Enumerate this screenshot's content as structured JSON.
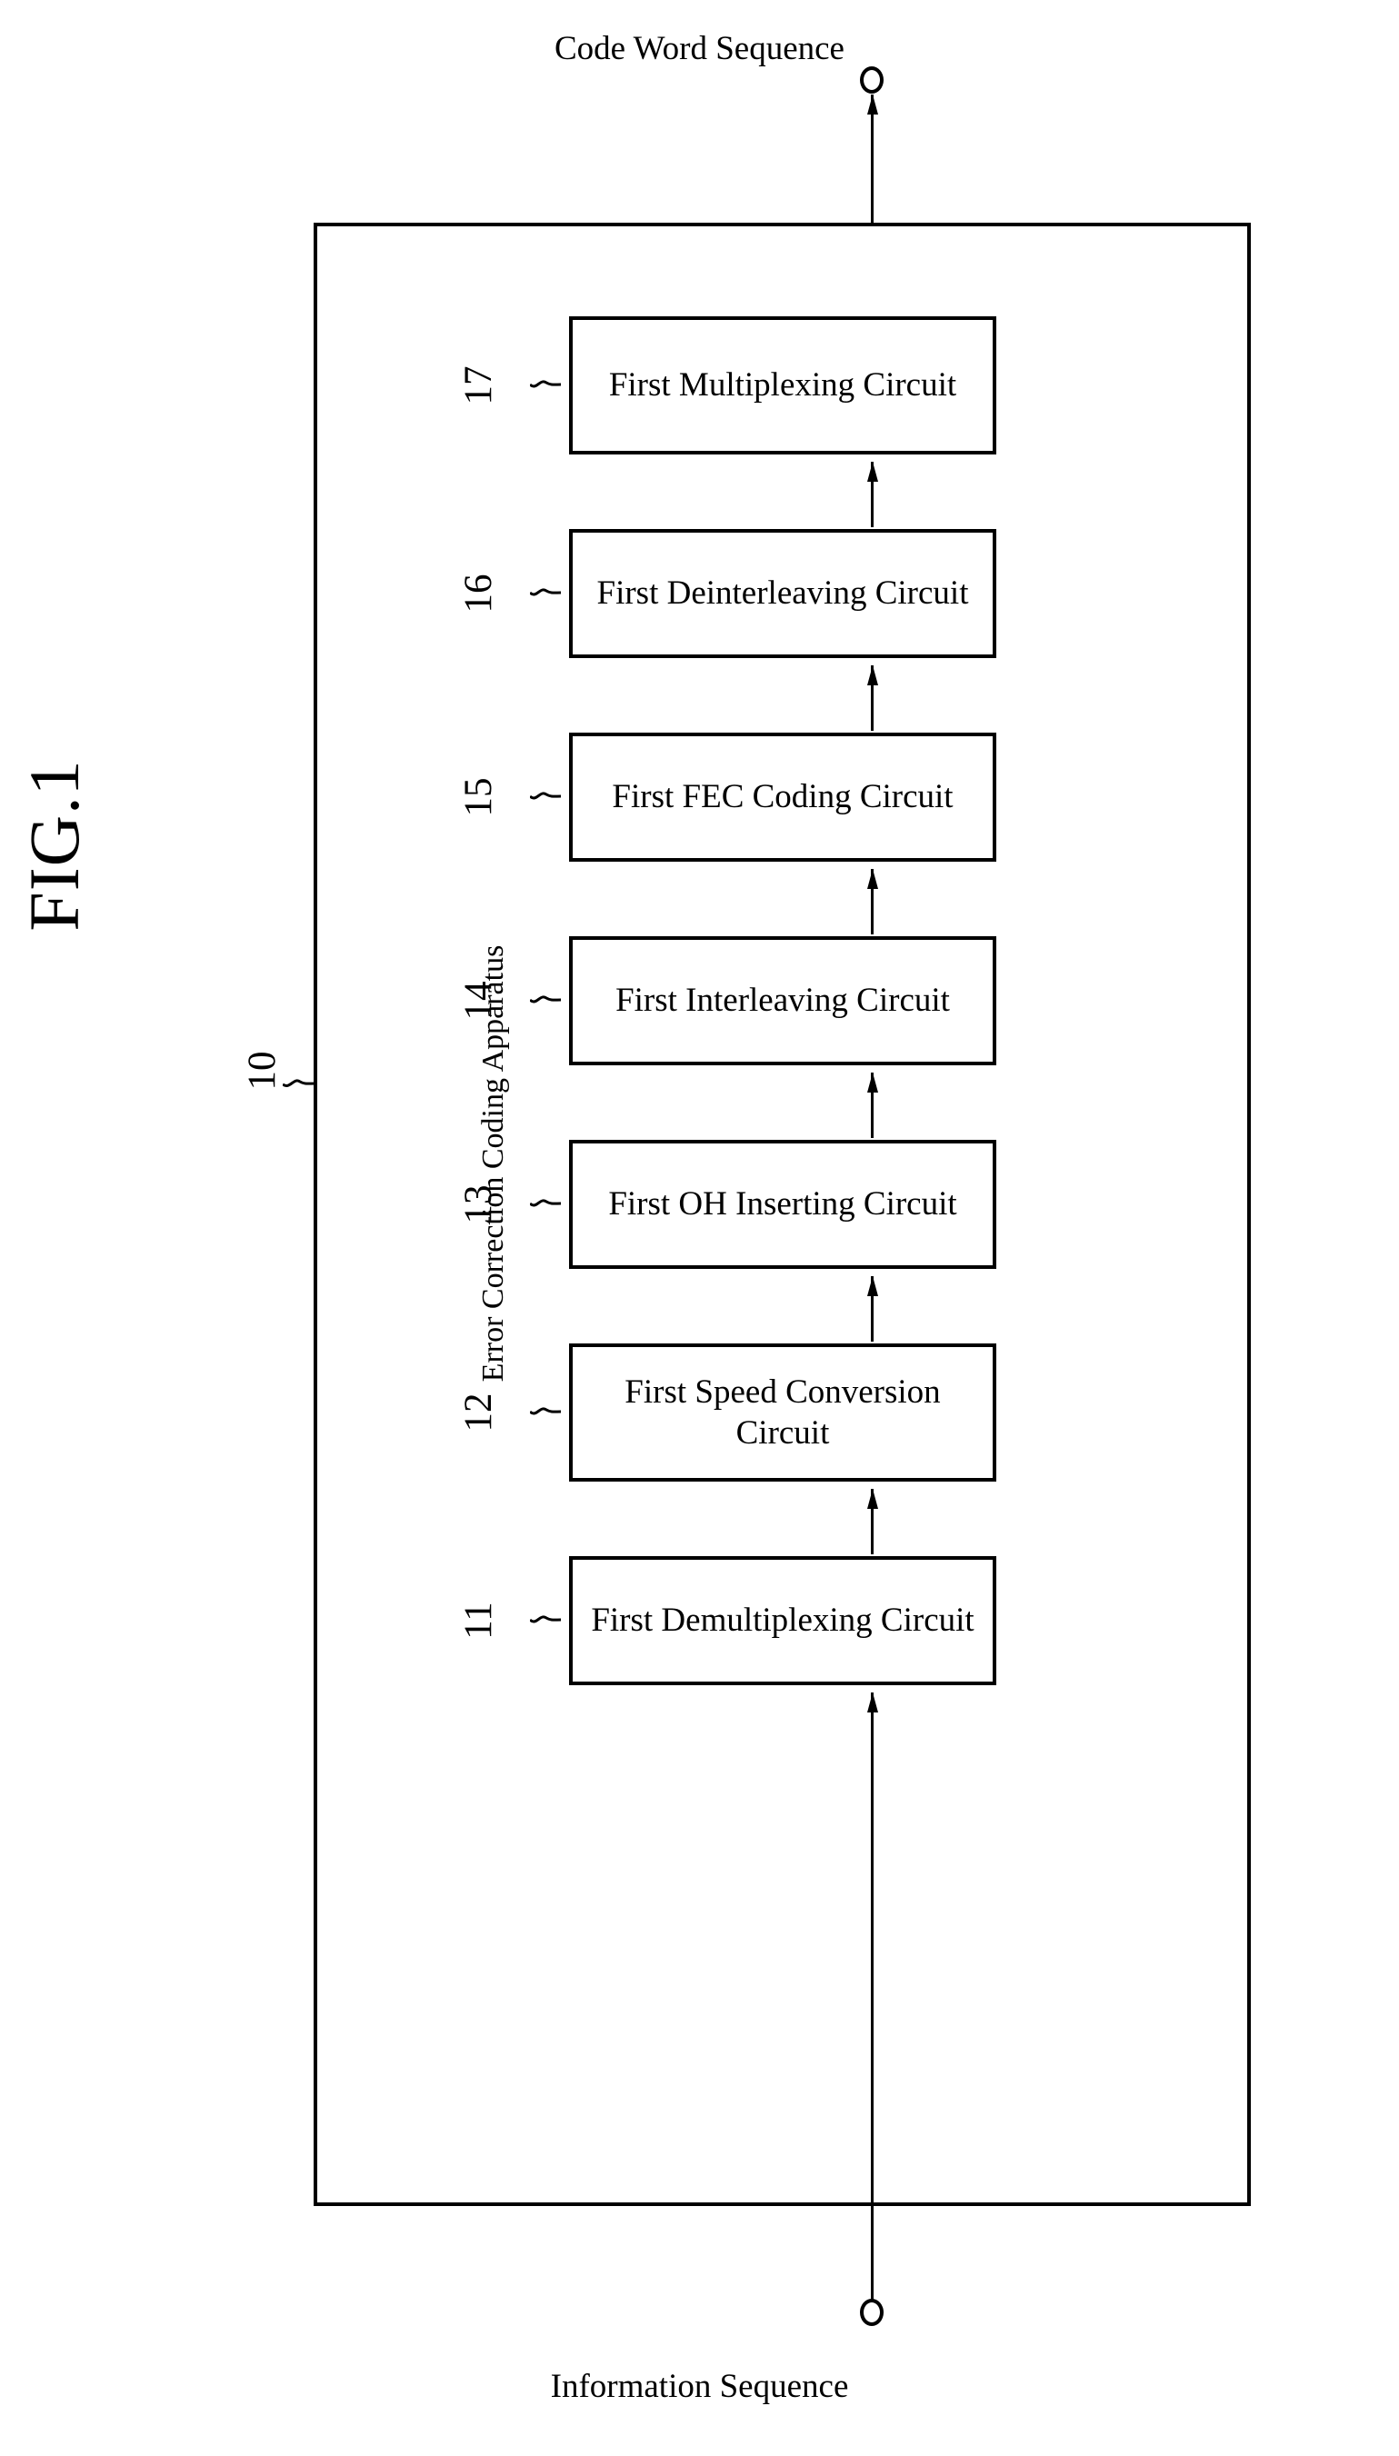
{
  "figure": {
    "label": "FIG.1"
  },
  "io": {
    "output_label": "Code Word Sequence",
    "input_label": "Information Sequence",
    "output_terminal_icon": "open-circle-terminal-icon",
    "input_terminal_icon": "open-circle-terminal-icon"
  },
  "apparatus": {
    "label": "Error Correction Coding Apparatus",
    "reference_numeral": "10"
  },
  "blocks": [
    {
      "ref": "17",
      "label": "First Multiplexing Circuit",
      "lines": [
        "First Multiplexing Circuit"
      ]
    },
    {
      "ref": "16",
      "label": "First Deinterleaving Circuit",
      "lines": [
        "First Deinterleaving Circuit"
      ]
    },
    {
      "ref": "15",
      "label": "First FEC Coding Circuit",
      "lines": [
        "First FEC Coding Circuit"
      ]
    },
    {
      "ref": "14",
      "label": "First Interleaving Circuit",
      "lines": [
        "First Interleaving Circuit"
      ]
    },
    {
      "ref": "13",
      "label": "First OH Inserting Circuit",
      "lines": [
        "First OH Inserting Circuit"
      ]
    },
    {
      "ref": "12",
      "label": "First Speed Conversion Circuit",
      "lines": [
        "First Speed Conversion",
        "Circuit"
      ]
    },
    {
      "ref": "11",
      "label": "First Demultiplexing Circuit",
      "lines": [
        "First Demultiplexing Circuit"
      ]
    }
  ],
  "colors": {
    "ink": "#000000",
    "paper": "#ffffff"
  }
}
